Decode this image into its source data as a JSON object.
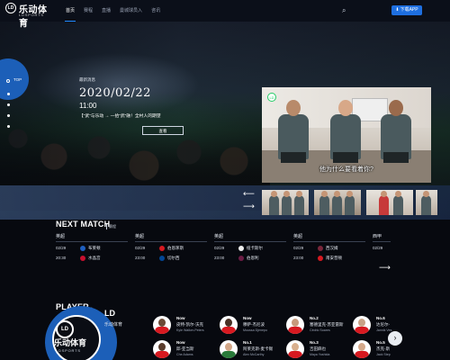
{
  "brand": {
    "badge": "LD",
    "name_cn": "乐动体育",
    "name_en": "LDSPORTS"
  },
  "nav": {
    "items": [
      {
        "label": "首页",
        "active": true
      },
      {
        "label": "赛程",
        "active": false
      },
      {
        "label": "直播",
        "active": false
      },
      {
        "label": "曼城球员入",
        "active": false
      },
      {
        "label": "咨讯",
        "active": false
      }
    ],
    "search_icon": "search-icon",
    "download_label": "下载APP",
    "download_icon": "download-icon"
  },
  "side_nav": {
    "top_label": "TOP",
    "dot_count": 4
  },
  "hero": {
    "news_label": "最新消息",
    "date": "2020/02/22",
    "time": "11:00",
    "headline": "【“武”与乐动 → 一拾“武”融！全村人的期望",
    "button_label": "查看"
  },
  "video": {
    "logo_label": "LD",
    "subtitle": "他为什么要看着你?"
  },
  "carousel": {
    "prev_arrow": "⟵",
    "next_arrow": "⟶"
  },
  "next_match": {
    "title": "NEXT MATCH",
    "tag": "赛程",
    "matches": [
      {
        "league": "英超",
        "date": "02/29",
        "time": "20:30",
        "home": "布莱顿",
        "away": "水晶宫",
        "home_color": "#1f5fbf",
        "away_color": "#c8102e"
      },
      {
        "league": "英超",
        "date": "02/29",
        "time": "23:00",
        "home": "伯恩茅斯",
        "away": "切尔西",
        "home_color": "#d71920",
        "away_color": "#034694"
      },
      {
        "league": "英超",
        "date": "02/29",
        "time": "23:00",
        "home": "纽卡斯尔",
        "away": "伯恩利",
        "home_color": "#eeeeee",
        "away_color": "#6c1d45"
      },
      {
        "league": "英超",
        "date": "02/29",
        "time": "23:00",
        "home": "西汉姆",
        "away": "南安普顿",
        "home_color": "#7a263a",
        "away_color": "#d71920"
      },
      {
        "league": "西甲",
        "date": "02/29",
        "time": "",
        "home": "",
        "away": "",
        "home_color": "#ffffff",
        "away_color": "#ffffff"
      }
    ],
    "more_arrow": "⟶"
  },
  "player_section": {
    "title": "PLAYER",
    "tag": "球员",
    "brand_title": "LD",
    "brand_sub": "乐动体育",
    "players": [
      {
        "no": "Now",
        "name": "皮特-凯尔-沃克",
        "en": "Kyle Walker-Peters",
        "role": "后卫",
        "shirt": "#d71920",
        "skin": "#6b4a36"
      },
      {
        "no": "Now",
        "name": "穆萨-杰尼波",
        "en": "Moussa Djenepo",
        "role": "前卫",
        "shirt": "#d71920",
        "skin": "#4a3226"
      },
      {
        "no": "No.2",
        "name": "塞德里克-苏亚雷斯",
        "en": "Cédric Soares",
        "role": "后卫",
        "shirt": "#d71920",
        "skin": "#c79a7c"
      },
      {
        "no": "No.6",
        "name": "达尼尔-",
        "en": "Jannik Ves",
        "role": "",
        "shirt": "#d71920",
        "skin": "#c8a286"
      },
      {
        "no": "Now",
        "name": "邱-亚当斯",
        "en": "Che Adams",
        "role": "前锋",
        "shirt": "#d71920",
        "skin": "#5a3c2c"
      },
      {
        "no": "No.1",
        "name": "阿莱克斯-麦卡锡",
        "en": "Alex McCarthy",
        "role": "门将",
        "shirt": "#2a7a3a",
        "skin": "#d2a788"
      },
      {
        "no": "No.3",
        "name": "吉田麻也",
        "en": "Maya Yoshida",
        "role": "后卫",
        "shirt": "#d71920",
        "skin": "#d9b08e"
      },
      {
        "no": "No.5",
        "name": "杰克-斯",
        "en": "Jack Step",
        "role": "",
        "shirt": "#d71920",
        "skin": "#d5a98a"
      }
    ],
    "next_arrow": "›"
  }
}
